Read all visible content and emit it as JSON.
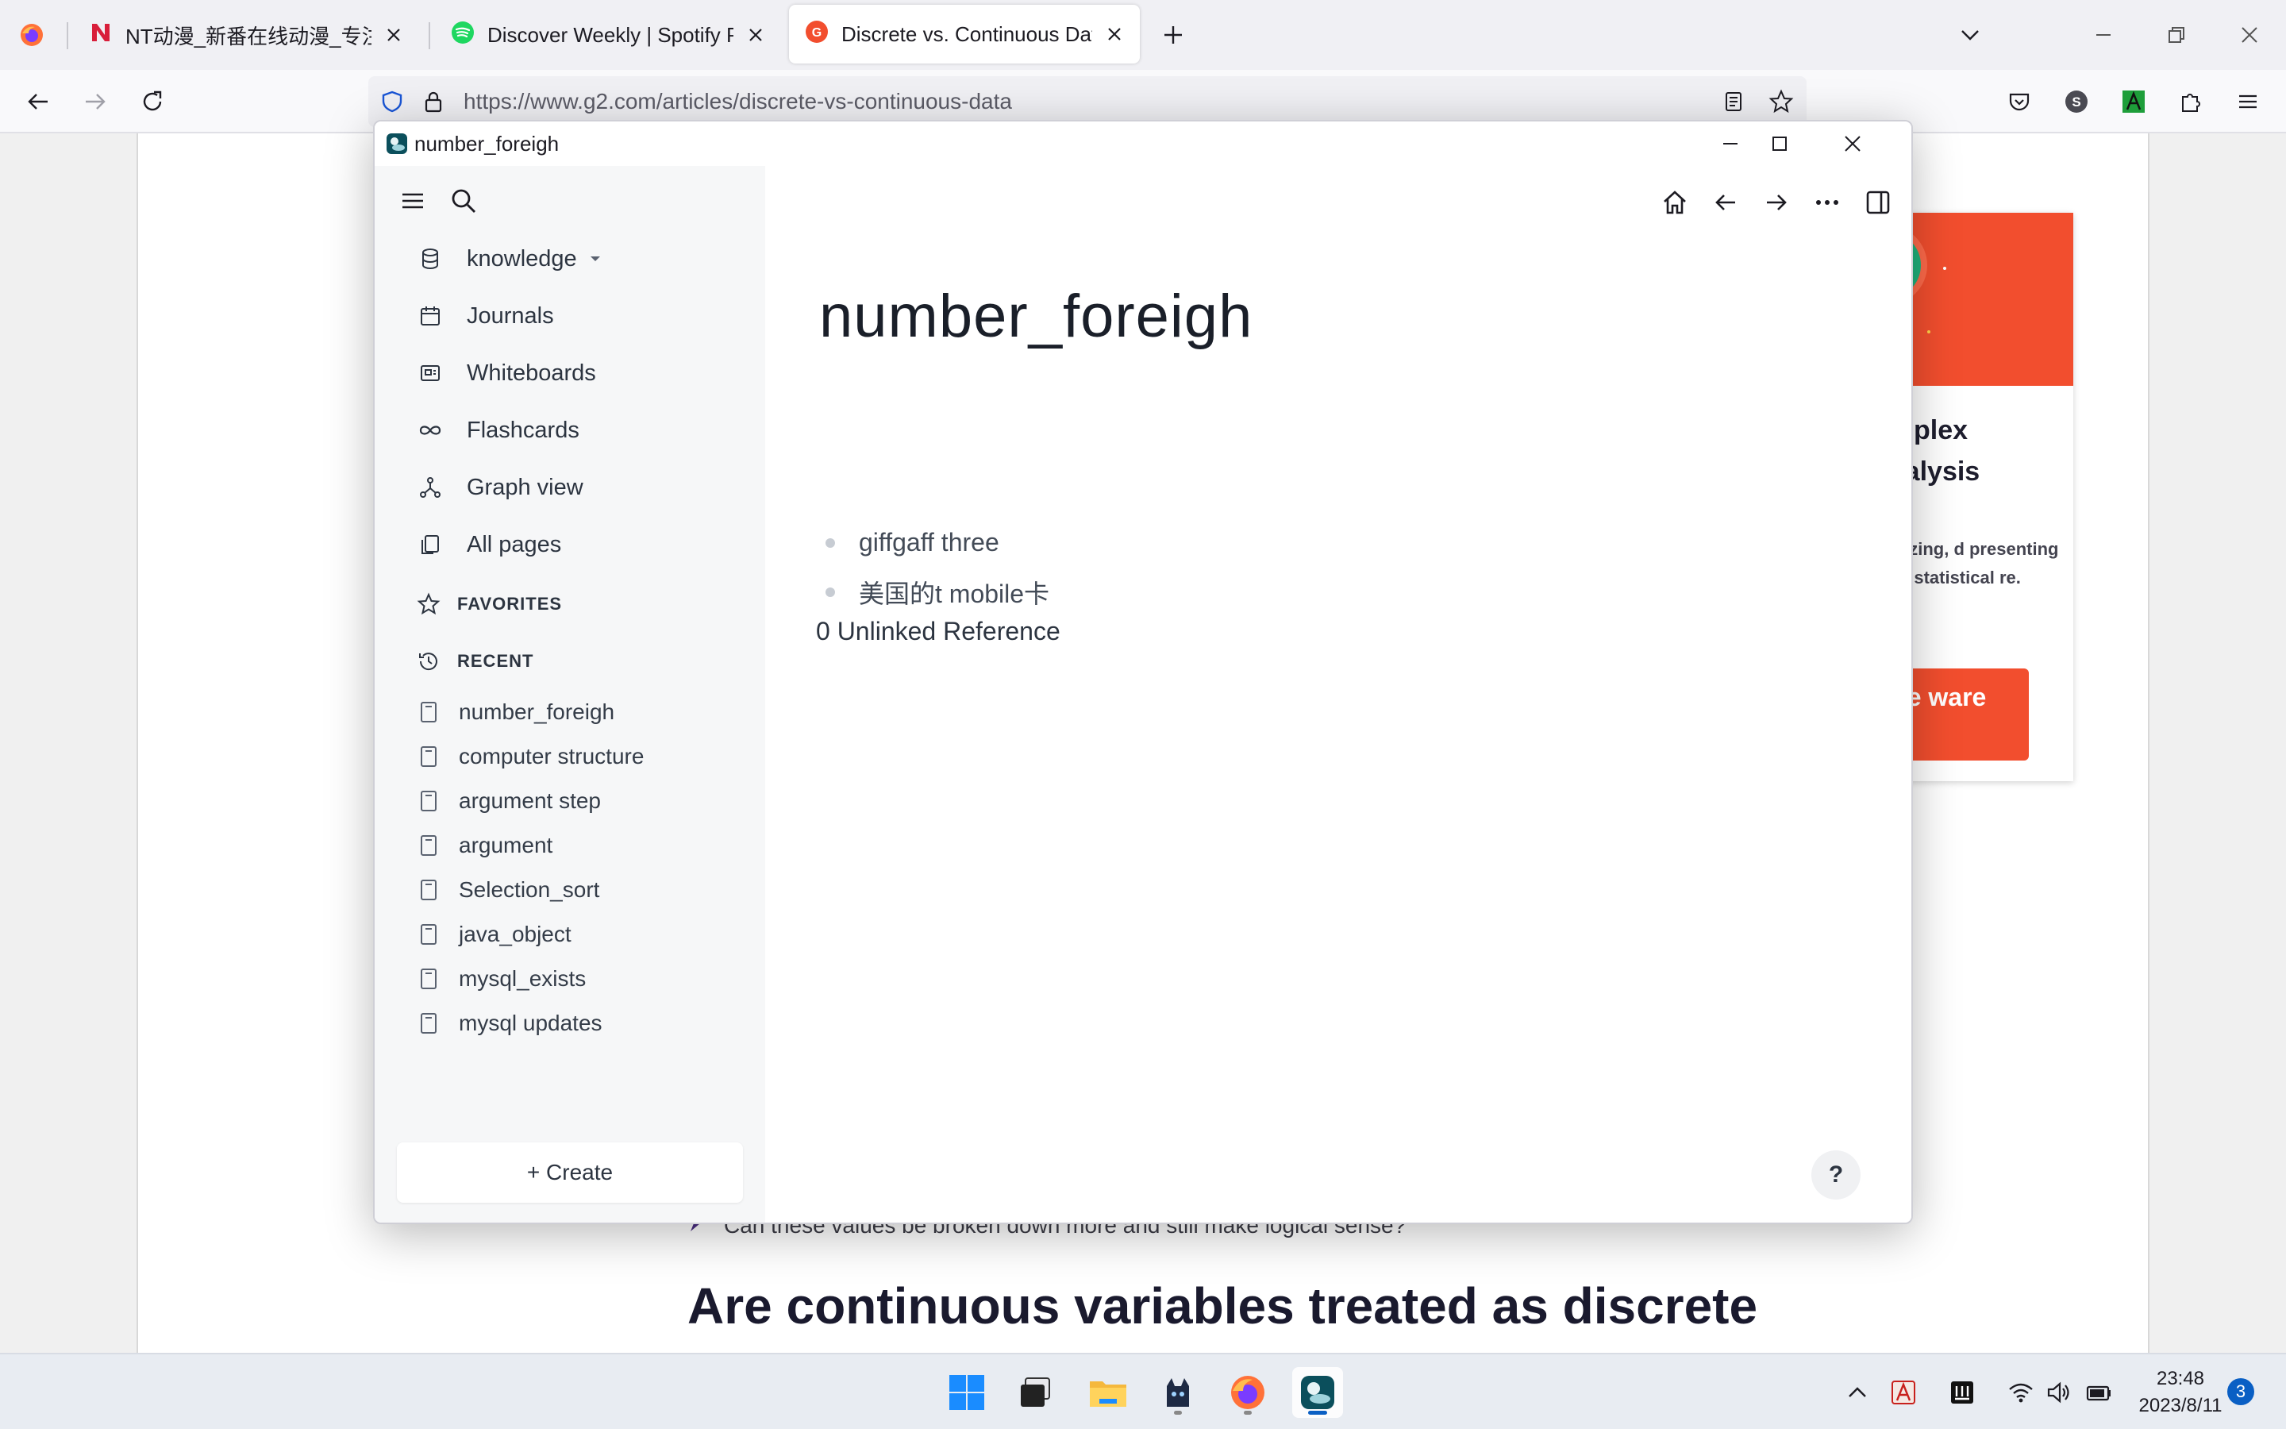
{
  "browser": {
    "tabs": [
      {
        "title": "NT动漫_新番在线动漫_专注动漫",
        "icon": "nt-anime-icon"
      },
      {
        "title": "Discover Weekly | Spotify Pla",
        "icon": "spotify-icon"
      },
      {
        "title": "Discrete vs. Continuous Data",
        "icon": "g2-icon",
        "active": true
      }
    ],
    "url": "https://www.g2.com/articles/discrete-vs-continuous-data"
  },
  "webpage": {
    "ad_title": "omplex analysis",
    "ad_desc": "ganizing, d presenting sing statistical re.",
    "ad_button": "wse ware",
    "question": "Can these values be broken down more and still make logical sense?",
    "heading": "Are continuous variables treated as discrete"
  },
  "app": {
    "window_title": "number_foreigh",
    "graph": "knowledge",
    "nav": [
      {
        "label": "Journals",
        "icon": "calendar-icon"
      },
      {
        "label": "Whiteboards",
        "icon": "whiteboard-icon"
      },
      {
        "label": "Flashcards",
        "icon": "infinity-icon"
      },
      {
        "label": "Graph view",
        "icon": "graph-icon"
      },
      {
        "label": "All pages",
        "icon": "pages-icon"
      }
    ],
    "favorites_label": "FAVORITES",
    "recent_label": "RECENT",
    "recent": [
      "number_foreigh",
      "computer structure",
      "argument step",
      "argument",
      "Selection_sort",
      "java_object",
      "mysql_exists",
      "mysql updates"
    ],
    "create_label": "+ Create",
    "page": {
      "title": "number_foreigh",
      "blocks": [
        "giffgaff three",
        "美国的t mobile卡"
      ],
      "unlinked": "0 Unlinked Reference"
    },
    "help_label": "?"
  },
  "taskbar": {
    "time": "23:48",
    "date": "2023/8/11",
    "notifications": "3",
    "apps": [
      "start-icon",
      "task-view-icon",
      "file-explorer-icon",
      "cat-app-icon",
      "firefox-icon",
      "logseq-icon"
    ]
  },
  "colors": {
    "accent_red": "#f24e2e",
    "windows_blue": "#0a5fc4"
  }
}
